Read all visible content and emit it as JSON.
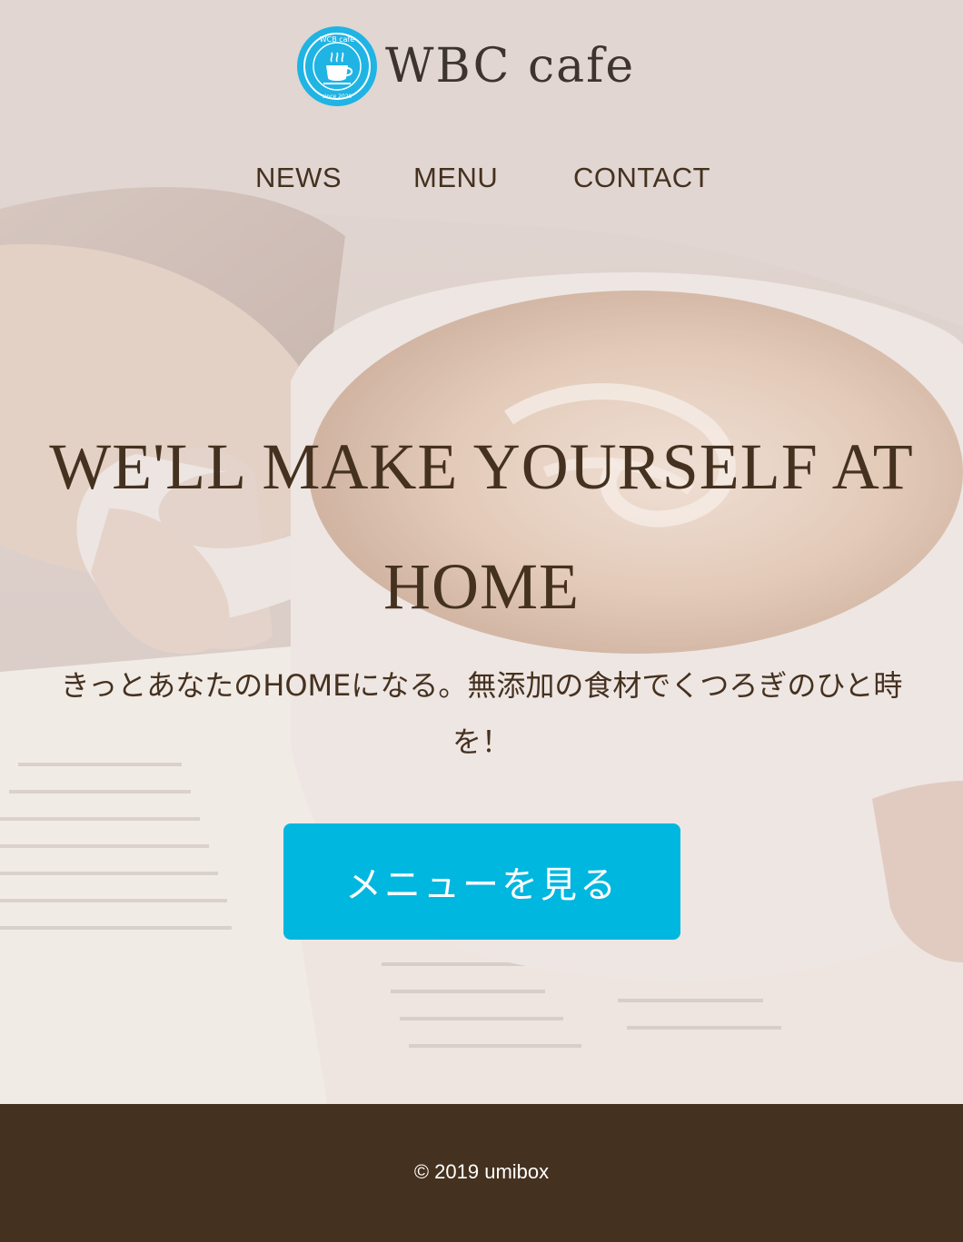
{
  "brand": {
    "name": "WBC cafe",
    "badge_top_text": "WCB cafe",
    "badge_bottom_text": "since 2020",
    "badge_color": "#1fb4e3",
    "icon": "coffee-cup-icon"
  },
  "nav": {
    "items": [
      {
        "label": "NEWS"
      },
      {
        "label": "MENU"
      },
      {
        "label": "CONTACT"
      }
    ]
  },
  "hero": {
    "headline": "WE'LL MAKE YOURSELF AT HOME",
    "subtext": "きっとあなたのHOMEになる。無添加の食材でくつろぎのひと時を！",
    "cta_label": "メニューを見る",
    "cta_color": "#00b7df",
    "text_color": "#45311f"
  },
  "footer": {
    "copyright": "© 2019 umibox",
    "background": "#45311f"
  }
}
